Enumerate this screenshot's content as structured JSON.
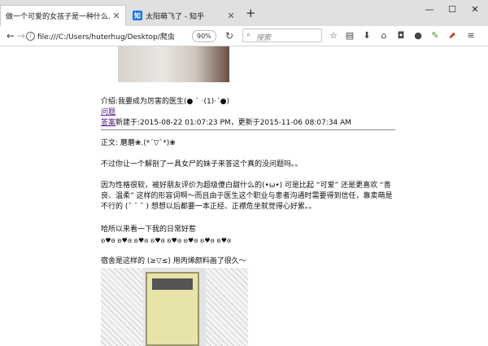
{
  "tabs": [
    {
      "title": "做一个可爱的女孩子是一种什么…",
      "active": true
    },
    {
      "title": "太阳萌飞了 - 知乎",
      "favicon": "知",
      "active": false
    }
  ],
  "toolbar": {
    "url": "file:///C:/Users/huterhug/Desktop/爬虫",
    "zoom": "90%",
    "search_placeholder": "搜索"
  },
  "post": {
    "intro": "介绍:我要成为厉害的医生(● ` ·(1)·´●)",
    "question_link": "问题",
    "answer_link": "答案",
    "meta": "新建于:2015-08-22 01:07:23 PM，更新于2015-11-06 08:07:34 AM",
    "body_title": "正文: 蘑蘑❀.(*´▽`*)❀",
    "p1": "不过你让一个解剖了一具女尸的妹子来答这个真的没问题吗。。",
    "p2": "因为性格很软，被好朋友评价为超级傻白甜什么的(•ω•) 可是比起 “可爱” 还是更喜欢 “善良、温柔” 这样的形容词啊～而且由于医生这个职业与患者沟通时需要得到信任，靠卖萌是不行的 (ˇ ˘ ˇ ) 想想以后都要一本正经、正襟危坐就觉得心好累。。",
    "p3": "哈所以来看一下我的日常好惹",
    "p4": "ʚ♥ɞ ʚ♥ɞ ʚ♥ɞ ʚ♥ɞ ʚ♥ɞ ʚ♥ɞ ʚ♥ɞ ʚ♥ɞ",
    "p5": "宿舍是这样的 (≥▽≤) 用丙烯颜料画了很久～"
  }
}
